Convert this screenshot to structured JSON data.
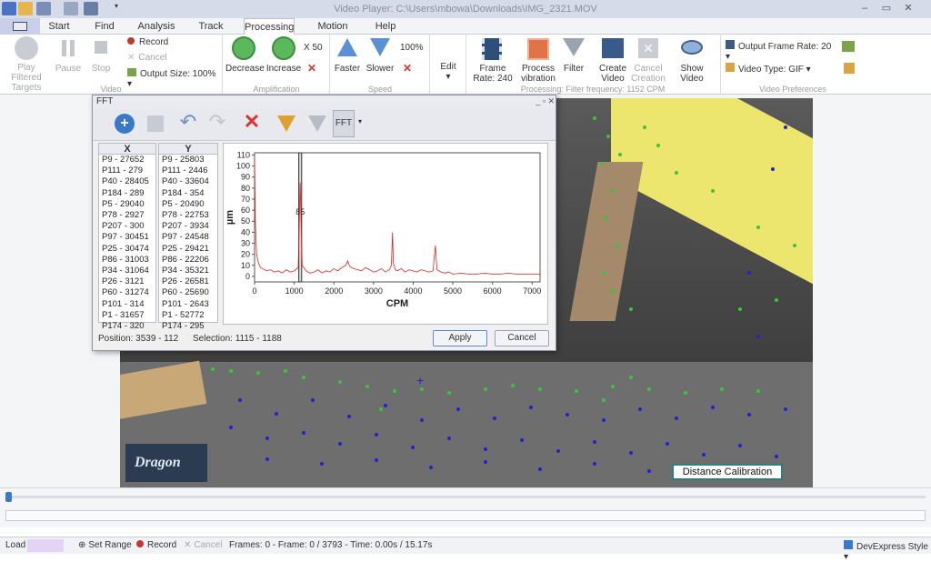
{
  "window": {
    "title": "Video Player: C:\\Users\\mbowa\\Downloads\\IMG_2321.MOV"
  },
  "tabs": [
    "Start",
    "Find Targets",
    "Analysis",
    "Track Targets",
    "Processing",
    "Motion Detection",
    "Help"
  ],
  "active_tab": "Processing",
  "ribbon": {
    "video": {
      "play": "Play Filtered Targets",
      "pause": "Pause",
      "stop": "Stop",
      "record": "Record",
      "cancel": "Cancel",
      "output_size": "Output Size: 100%",
      "group": "Video"
    },
    "amplification": {
      "decrease": "Decrease",
      "increase": "Increase",
      "factor": "X 50",
      "group": "Amplification"
    },
    "speed": {
      "faster": "Faster",
      "slower": "Slower",
      "value": "100%",
      "group": "Speed"
    },
    "edit": {
      "label": "Edit"
    },
    "processing": {
      "frame_rate": "Frame Rate: 240",
      "process": "Process vibration",
      "filter": "Filter",
      "create": "Create Video",
      "cancel_creation": "Cancel Creation",
      "show": "Show Video",
      "group": "Processing: Filter frequency: 1152 CPM"
    },
    "prefs": {
      "output_frame_rate": "Output Frame Rate: 20",
      "video_type": "Video Type: GIF",
      "group": "Video Preferences"
    }
  },
  "fft_dialog": {
    "title": "FFT",
    "fft_button": "FFT",
    "x_header": "X",
    "y_header": "Y",
    "x_items": [
      "P9 - 27652",
      "P111 - 279",
      "P40 - 28405",
      "P184 - 289",
      "P5 - 29040",
      "P78 - 2927",
      "P207 - 300",
      "P97 - 30451",
      "P25 - 30474",
      "P86 - 31003",
      "P34 - 31064",
      "P26 - 3121",
      "P60 - 31274",
      "P101 - 314",
      "P1 - 31657",
      "P174 - 320"
    ],
    "y_items": [
      "P9 - 25803",
      "P111 - 2446",
      "P40 - 33604",
      "P184 - 354",
      "P5 - 20490",
      "P78 - 22753",
      "P207 - 3934",
      "P97 - 24548",
      "P25 - 29421",
      "P86 - 22206",
      "P34 - 35321",
      "P26 - 26581",
      "P60 - 25690",
      "P101 - 2643",
      "P1 - 52772",
      "P174 - 295"
    ],
    "position": "Position: 3539 - 112",
    "selection": "Selection: 1115 - 1188",
    "apply": "Apply",
    "cancel": "Cancel"
  },
  "chart_data": {
    "type": "line",
    "xlabel": "CPM",
    "ylabel": "µm",
    "xlim": [
      0,
      7200
    ],
    "ylim": [
      -5,
      112
    ],
    "xticks": [
      0,
      1000,
      2000,
      3000,
      4000,
      5000,
      6000,
      7000
    ],
    "yticks": [
      0,
      10,
      20,
      30,
      40,
      50,
      60,
      70,
      80,
      90,
      100,
      110
    ],
    "selection": [
      1115,
      1188
    ],
    "selection_label": "85",
    "series": [
      {
        "color": "#e02020",
        "x": [
          0,
          20,
          50,
          100,
          150,
          200,
          300,
          400,
          500,
          600,
          700,
          800,
          900,
          1000,
          1100,
          1150,
          1200,
          1300,
          1400,
          1500,
          1600,
          1700,
          1800,
          1900,
          2000,
          2100,
          2200,
          2300,
          2350,
          2400,
          2500,
          2600,
          2700,
          2800,
          2900,
          3000,
          3100,
          3200,
          3300,
          3400,
          3450,
          3480,
          3500,
          3550,
          3600,
          3700,
          3800,
          3900,
          4000,
          4100,
          4200,
          4300,
          4400,
          4500,
          4560,
          4600,
          4700,
          4800,
          4900,
          5000,
          5200,
          5400,
          5600,
          5800,
          6000,
          6200,
          6400,
          6600,
          6800,
          7000,
          7200
        ],
        "y": [
          108,
          50,
          20,
          12,
          8,
          7,
          5,
          6,
          4,
          5,
          3,
          6,
          4,
          5,
          8,
          85,
          10,
          5,
          3,
          4,
          6,
          3,
          5,
          4,
          7,
          5,
          8,
          10,
          14,
          9,
          7,
          6,
          5,
          8,
          6,
          4,
          5,
          7,
          4,
          6,
          10,
          40,
          12,
          6,
          5,
          7,
          4,
          6,
          5,
          4,
          6,
          5,
          4,
          5,
          28,
          6,
          4,
          3,
          4,
          2,
          3,
          2,
          2,
          3,
          2,
          2,
          3,
          2,
          2,
          2,
          2
        ]
      }
    ]
  },
  "video_overlay": {
    "distance_calibration": "Distance Calibration",
    "logo_text": "Dragon"
  },
  "statusbar": {
    "load": "Load",
    "set_range": "Set Range",
    "record": "Record",
    "cancel": "Cancel",
    "frames": "Frames: 0 - Frame: 0 / 3793 - Time: 0.00s / 15.17s",
    "style": "DevExpress Style"
  }
}
